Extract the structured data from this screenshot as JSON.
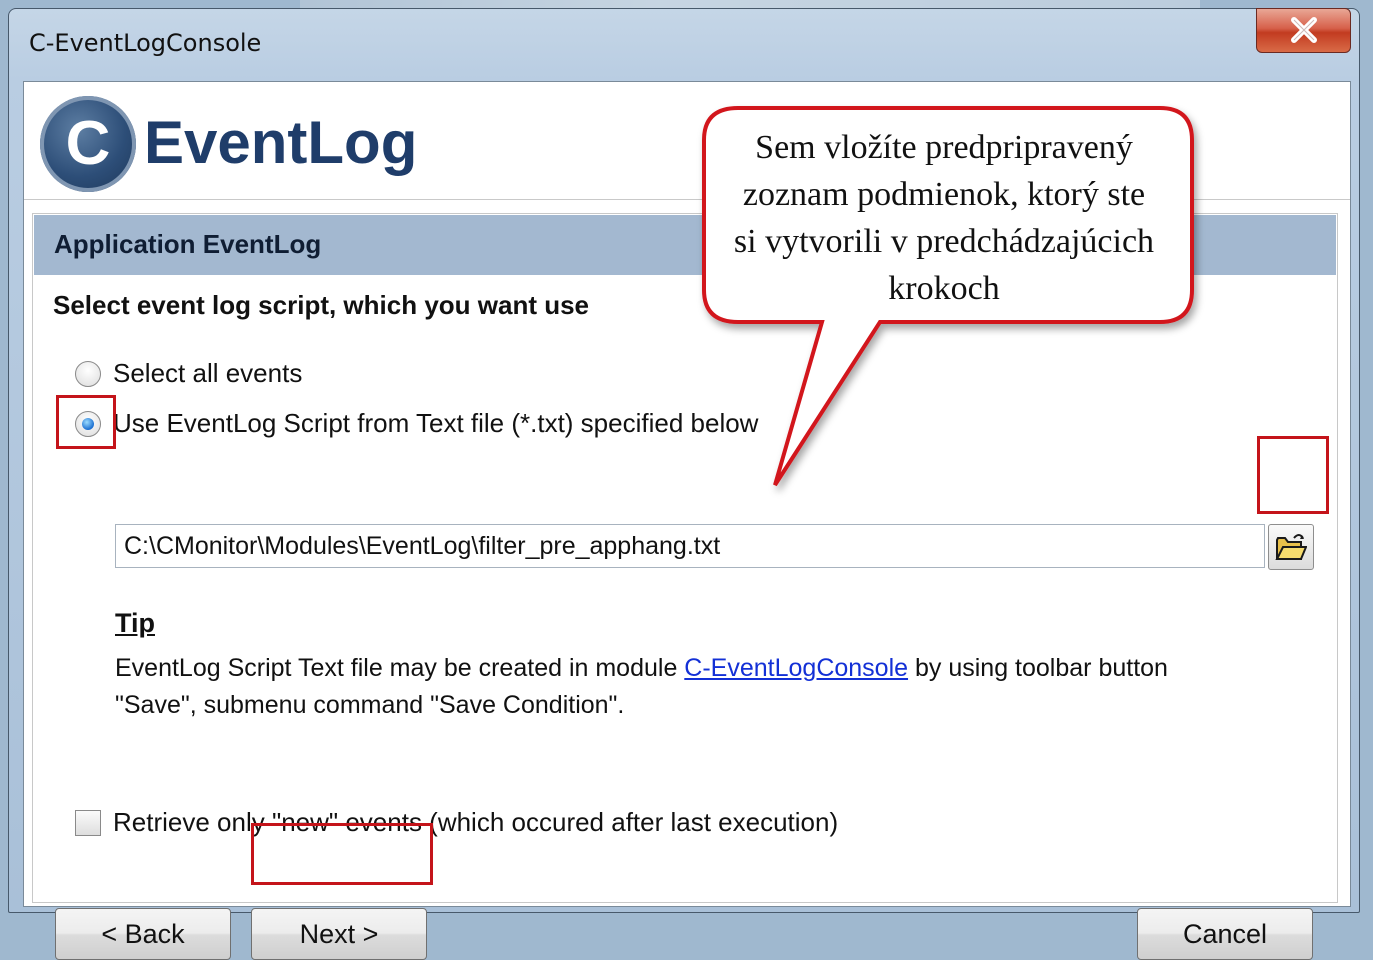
{
  "window": {
    "title": "C-EventLogConsole",
    "close_label": "X"
  },
  "logo": {
    "letter": "C",
    "text": "EventLog"
  },
  "section": {
    "title": "Application EventLog",
    "subheading": "Select event log script, which you want use"
  },
  "options": {
    "all_events": "Select all events",
    "script_file": "Use EventLog Script from Text file (*.txt) specified below",
    "selected": "script_file"
  },
  "path_input": {
    "value": "C:\\CMonitor\\Modules\\EventLog\\filter_pre_apphang.txt"
  },
  "tip": {
    "title": "Tip",
    "text_before": "EventLog Script Text file may be created in module ",
    "link": "C-EventLogConsole",
    "text_after": " by using toolbar button \"Save\", submenu command \"Save Condition\"."
  },
  "retrieve_new": {
    "label": "Retrieve only \"new\" events (which occured after last execution)",
    "checked": false
  },
  "buttons": {
    "back": "< Back",
    "next": "Next >",
    "cancel": "Cancel"
  },
  "callout": {
    "line1": "Sem vložíte predpripravený",
    "line2": "zoznam podmienok, ktorý ste",
    "line3": "si vytvorili v predchádzajúcich",
    "line4": "krokoch"
  },
  "colors": {
    "highlight": "#c4141a",
    "section_bg": "#a3b8d0",
    "link": "#1330d6"
  },
  "icons": {
    "close": "close-icon",
    "browse": "open-folder-icon"
  }
}
